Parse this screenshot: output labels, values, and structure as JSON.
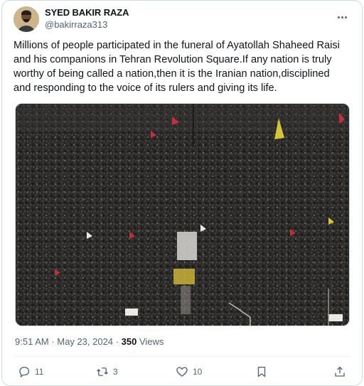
{
  "user": {
    "display_name": "SYED BAKIR RAZA",
    "handle": "@bakirraza313"
  },
  "post": {
    "text": "Millions of people participated in the funeral of Ayatollah Shaheed Raisi and his companions in Tehran Revolution Square.If any nation is truly worthy of being called a nation,then it is the Iranian nation,disciplined and responding to the voice of its rulers and giving its life.",
    "time": "9:51 AM",
    "separator": " · ",
    "date": "May 23, 2024",
    "views_count": "350",
    "views_label": "Views"
  },
  "actions": {
    "replies": "11",
    "reposts": "3",
    "likes": "10"
  },
  "icons": [
    "more-icon",
    "reply-icon",
    "repost-icon",
    "like-icon",
    "bookmark-icon",
    "share-icon"
  ],
  "colors": {
    "text": "#0f1419",
    "secondary": "#536471",
    "border": "#cfd9de"
  }
}
